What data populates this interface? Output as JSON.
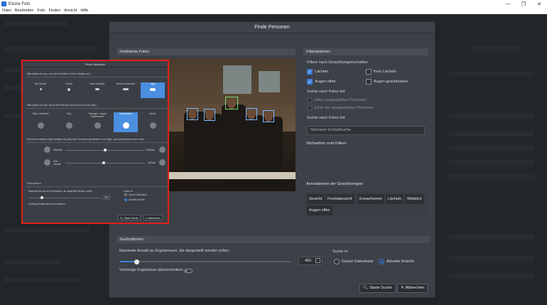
{
  "window": {
    "title": "Excire Foto",
    "controls": [
      "—",
      "❐",
      "✕"
    ]
  },
  "menu": [
    "Datei",
    "Bearbeiten",
    "Foto",
    "Finden",
    "Ansicht",
    "Hilfe"
  ],
  "dialog": {
    "title": "Finde Personen",
    "selected_photos_label": "Selektierte Fotos:",
    "filter_options_label": "Filteroptionen:",
    "face_props_label": "Filtern nach Gesichtseigenschaften",
    "checkboxes": [
      {
        "label": "Lächeln",
        "checked": true
      },
      {
        "label": "Kein Lächeln",
        "checked": false
      },
      {
        "label": "Augen offen",
        "checked": true
      },
      {
        "label": "Augen geschlossen",
        "checked": false
      }
    ],
    "search_photos_with_1": "Suche nach Fotos mit",
    "radio_any": "Allen ausgewählten Personen",
    "radio_one": "Einer der ausgewählten Personen",
    "search_photos_with_2": "Suche nach Fotos mit",
    "keyword_placeholder": "Stichwort Schnellsuche",
    "keywords_filter_label": "Stichwörter zum Filtern:",
    "annotations_label": "Annotationen der Gesichtsregion",
    "chips": [
      "Gesicht",
      "Frontalansicht",
      "Erwachsener",
      "Lächeln",
      "Weiblich",
      "Augen offen"
    ],
    "search_options_label": "Suchoptionen:",
    "max_results_label": "Maximale Anzahl an Ergebnissen, die dargestellt werden sollen:",
    "max_results_value": "450",
    "max_results_fraction": 0.05,
    "search_in_label": "Suche in:",
    "scope_db": "Ganze Datenbank",
    "scope_view": "Aktuelle Ansicht",
    "overwrite_label": "Vorherige Ergebnisse überschreiben:",
    "start_button": "Starte Suche",
    "cancel_button": "Abbrechen"
  },
  "inset": {
    "title": "Finde Gesichter",
    "q1": "Bitte wählen Sie aus, wie viele Gesichter im Foto enthalten soll:",
    "count_options": [
      "Ein Gesicht",
      "Porträt",
      "Zwei Gesichter",
      "Mehrere Gesichter",
      "Egal"
    ],
    "q2": "Bitte wählen Sie aus, wie alt die Personen auf einem Foto sein sollen:",
    "age_options": [
      "Baby / Kleinkind",
      "Kind",
      "Teenager / Junger Erwachsener",
      "Erwachsener",
      "Senior"
    ],
    "q3": "Sie können weiteres Eigenschaften der gesuchten Gesichter spezifizieren und regeln, wie dominant diese sein sollen:",
    "male": "Männlich",
    "female": "Weiblich",
    "no_smile": "Kein Lächeln",
    "smile": "Lächeln",
    "search_options": "Suchoptionen:",
    "max_label": "Maximale Anzahl an Ergebnissen, die dargestellt werden sollen:",
    "max_value": "900",
    "search_in": "Suche in:",
    "db": "Ganze Datenbank",
    "view": "Aktuelle Ansicht",
    "overwrite": "Vorherige Ergebnisse überschreiben:",
    "start": "Starte Suche",
    "cancel": "Abbrechen"
  }
}
